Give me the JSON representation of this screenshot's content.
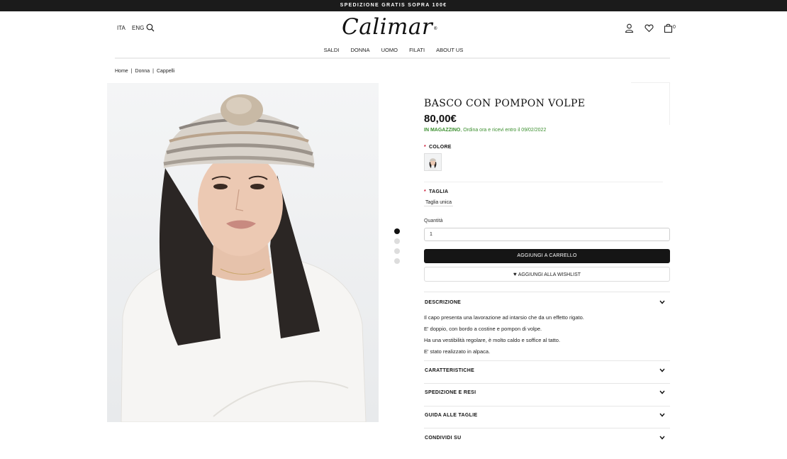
{
  "topbar": {
    "text": "SPEDIZIONE GRATIS SOPRA 100€"
  },
  "header": {
    "lang_ita": "ITA",
    "lang_eng": "ENG",
    "logo": "Calimar",
    "logo_mark": "®",
    "cart_count": "0",
    "nav": [
      "SALDI",
      "DONNA",
      "UOMO",
      "FILATI",
      "ABOUT US"
    ]
  },
  "breadcrumb": [
    "Home",
    "Donna",
    "Cappelli"
  ],
  "breadcrumb_sep": "|",
  "product": {
    "title": "BASCO CON POMPON VOLPE",
    "price": "80,00€",
    "stock_status": "IN MAGAZZINO",
    "stock_detail": ", Ordina ora e ricevi entro il 09/02/2022",
    "color_label": "COLORE",
    "size_label": "TAGLIA",
    "size_value": "Taglia unica",
    "qty_label": "Quantità",
    "qty_value": "1",
    "add_to_cart": "AGGIUNGI A CARRELLO",
    "add_to_wishlist": "AGGIUNGI ALLA WISHLIST",
    "required_mark": "*"
  },
  "gallery": {
    "count": 4,
    "active_index": 0
  },
  "accordion": {
    "descrizione": "DESCRIZIONE",
    "caratteristiche": "CARATTERISTICHE",
    "spedizione": "SPEDIZIONE E RESI",
    "guida": "GUIDA ALLE TAGLIE",
    "condividi": "CONDIVIDI SU"
  },
  "description_lines": [
    "Il capo presenta una lavorazione ad intarsio che da un effetto rigato.",
    "E' doppio, con bordo a costine e pompon di volpe.",
    "Ha una vestibilità regolare, è molto caldo e soffice al tatto.",
    "E' stato realizzato in alpaca."
  ],
  "colors": {
    "topbar_bg": "#1b1b1b",
    "stock_green": "#3b8f2e",
    "required_red": "#c8102e",
    "button_dark": "#151515"
  }
}
